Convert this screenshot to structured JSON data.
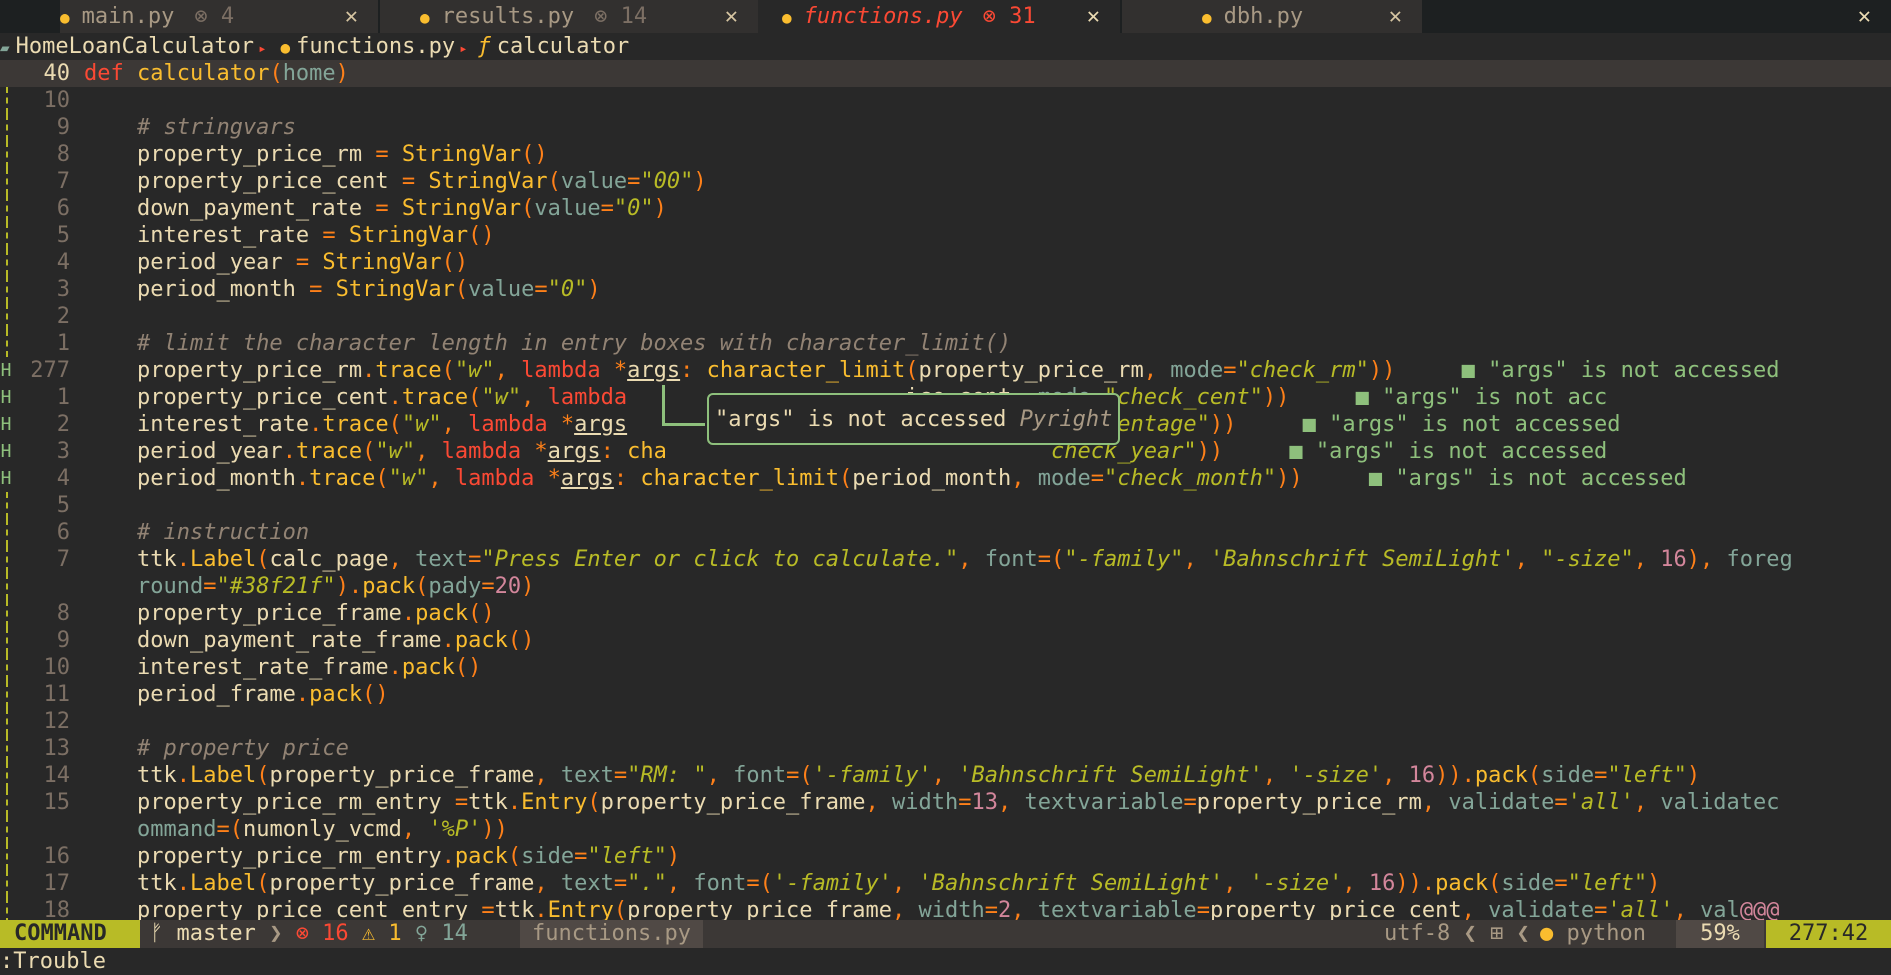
{
  "tabs": [
    {
      "name": "main.py",
      "diag": "⊗ 4",
      "close": "✕"
    },
    {
      "name": "results.py",
      "diag": "⊗ 14",
      "close": "✕"
    },
    {
      "name": "functions.py",
      "diag": "⊗ 31",
      "close": "✕"
    },
    {
      "name": "dbh.py",
      "diag": "",
      "close": "✕"
    }
  ],
  "window_close": "✕",
  "breadcrumb": {
    "project": "HomeLoanCalculator",
    "file": "functions.py",
    "symbol": "calculator"
  },
  "hover": {
    "message": "\"args\" is not accessed",
    "source": "Pyright"
  },
  "diagnostic_hint": "■ \"args\" is not accessed",
  "status": {
    "mode": "COMMAND",
    "branch": "master",
    "errors": "⊗ 16",
    "warnings": "⚠ 1",
    "hints": "♀ 14",
    "file": "functions.py",
    "encoding": "utf-8",
    "filetype": "python",
    "percent": "59%",
    "position": "277:42"
  },
  "cmdline": ":Trouble",
  "lines": [
    {
      "mk": "",
      "n": "40",
      "cur": true
    },
    {
      "mk": "bar",
      "n": "10"
    },
    {
      "mk": "bar",
      "n": "9"
    },
    {
      "mk": "bar",
      "n": "8"
    },
    {
      "mk": "bar",
      "n": "7"
    },
    {
      "mk": "bar",
      "n": "6"
    },
    {
      "mk": "bar",
      "n": "5"
    },
    {
      "mk": "bar",
      "n": "4"
    },
    {
      "mk": "bar",
      "n": "3"
    },
    {
      "mk": "bar",
      "n": "2"
    },
    {
      "mk": "bar",
      "n": "1"
    },
    {
      "mk": "H",
      "n": "277"
    },
    {
      "mk": "H",
      "n": "1"
    },
    {
      "mk": "H",
      "n": "2"
    },
    {
      "mk": "H",
      "n": "3"
    },
    {
      "mk": "H",
      "n": "4"
    },
    {
      "mk": "bar",
      "n": "5"
    },
    {
      "mk": "bar",
      "n": "6"
    },
    {
      "mk": "bar",
      "n": "7"
    },
    {
      "mk": "bar",
      "n": ""
    },
    {
      "mk": "bar",
      "n": "8"
    },
    {
      "mk": "bar",
      "n": "9"
    },
    {
      "mk": "bar",
      "n": "10"
    },
    {
      "mk": "bar",
      "n": "11"
    },
    {
      "mk": "bar",
      "n": "12"
    },
    {
      "mk": "bar",
      "n": "13"
    },
    {
      "mk": "bar",
      "n": "14"
    },
    {
      "mk": "bar",
      "n": "15"
    },
    {
      "mk": "bar",
      "n": ""
    },
    {
      "mk": "bar",
      "n": "16"
    },
    {
      "mk": "bar",
      "n": "17"
    },
    {
      "mk": "bar",
      "n": "18"
    }
  ],
  "code": [
    [
      [
        "kw",
        "def "
      ],
      [
        "fn",
        "calculator"
      ],
      [
        "pu",
        "("
      ],
      [
        "par",
        "home"
      ],
      [
        "pu",
        ")"
      ]
    ],
    [],
    [
      [
        "cm",
        "    # stringvars"
      ]
    ],
    [
      [
        "",
        "    property_price_rm "
      ],
      [
        "op",
        "="
      ],
      [
        "fn",
        " StringVar"
      ],
      [
        "pu",
        "()"
      ]
    ],
    [
      [
        "",
        "    property_price_cent "
      ],
      [
        "op",
        "="
      ],
      [
        "fn",
        " StringVar"
      ],
      [
        "pu",
        "("
      ],
      [
        "par",
        "value"
      ],
      [
        "op",
        "="
      ],
      [
        "st",
        "\"00\""
      ],
      [
        "pu",
        ")"
      ]
    ],
    [
      [
        "",
        "    down_payment_rate "
      ],
      [
        "op",
        "="
      ],
      [
        "fn",
        " StringVar"
      ],
      [
        "pu",
        "("
      ],
      [
        "par",
        "value"
      ],
      [
        "op",
        "="
      ],
      [
        "st",
        "\"0\""
      ],
      [
        "pu",
        ")"
      ]
    ],
    [
      [
        "",
        "    interest_rate "
      ],
      [
        "op",
        "="
      ],
      [
        "fn",
        " StringVar"
      ],
      [
        "pu",
        "()"
      ]
    ],
    [
      [
        "",
        "    period_year "
      ],
      [
        "op",
        "="
      ],
      [
        "fn",
        " StringVar"
      ],
      [
        "pu",
        "()"
      ]
    ],
    [
      [
        "",
        "    period_month "
      ],
      [
        "op",
        "="
      ],
      [
        "fn",
        " StringVar"
      ],
      [
        "pu",
        "("
      ],
      [
        "par",
        "value"
      ],
      [
        "op",
        "="
      ],
      [
        "st",
        "\"0\""
      ],
      [
        "pu",
        ")"
      ]
    ],
    [],
    [
      [
        "cm",
        "    # limit the character length in entry boxes with character_limit()"
      ]
    ],
    [
      [
        "",
        "    property_price_rm"
      ],
      [
        "op",
        "."
      ],
      [
        "fn",
        "trace"
      ],
      [
        "pu",
        "("
      ],
      [
        "st",
        "\"w\""
      ],
      [
        "pu",
        ", "
      ],
      [
        "kw",
        "lambda "
      ],
      [
        "op",
        "*"
      ],
      [
        "ul",
        "args"
      ],
      [
        "pu",
        ": "
      ],
      [
        "fn",
        "character_limit"
      ],
      [
        "pu",
        "("
      ],
      [
        "",
        "property_price_rm"
      ],
      [
        "pu",
        ", "
      ],
      [
        "par",
        "mode"
      ],
      [
        "op",
        "="
      ],
      [
        "st",
        "\"check_rm\""
      ],
      [
        "pu",
        "))"
      ],
      [
        "",
        "     "
      ],
      [
        "hint",
        "■ \"args\" is not accessed"
      ]
    ],
    [
      [
        "",
        "    property_price_cent"
      ],
      [
        "op",
        "."
      ],
      [
        "fn",
        "trace"
      ],
      [
        "pu",
        "("
      ],
      [
        "st",
        "\"w\""
      ],
      [
        "pu",
        ", "
      ],
      [
        "kw",
        "lambda"
      ],
      [
        "",
        "                     ice_cent"
      ],
      [
        "pu",
        ", "
      ],
      [
        "par",
        "mode"
      ],
      [
        "op",
        "="
      ],
      [
        "st",
        "\"check_cent\""
      ],
      [
        "pu",
        "))"
      ],
      [
        "",
        "     "
      ],
      [
        "hint",
        "■ \"args\" is not acc"
      ]
    ],
    [
      [
        "",
        "    interest_rate"
      ],
      [
        "op",
        "."
      ],
      [
        "fn",
        "trace"
      ],
      [
        "pu",
        "("
      ],
      [
        "st",
        "\"w\""
      ],
      [
        "pu",
        ", "
      ],
      [
        "kw",
        "lambda "
      ],
      [
        "op",
        "*"
      ],
      [
        "ul",
        "args"
      ],
      [
        "",
        "                       de"
      ],
      [
        "op",
        "="
      ],
      [
        "st",
        "\"check_percentage\""
      ],
      [
        "pu",
        "))"
      ],
      [
        "",
        "     "
      ],
      [
        "hint",
        "■ \"args\" is not accessed"
      ]
    ],
    [
      [
        "",
        "    period_year"
      ],
      [
        "op",
        "."
      ],
      [
        "fn",
        "trace"
      ],
      [
        "pu",
        "("
      ],
      [
        "st",
        "\"w\""
      ],
      [
        "pu",
        ", "
      ],
      [
        "kw",
        "lambda "
      ],
      [
        "op",
        "*"
      ],
      [
        "ul",
        "args"
      ],
      [
        "pu",
        ": "
      ],
      [
        "fn",
        "cha"
      ],
      [
        "",
        "                             "
      ],
      [
        "st",
        "check_year\""
      ],
      [
        "pu",
        "))"
      ],
      [
        "",
        "     "
      ],
      [
        "hint",
        "■ \"args\" is not accessed"
      ]
    ],
    [
      [
        "",
        "    period_month"
      ],
      [
        "op",
        "."
      ],
      [
        "fn",
        "trace"
      ],
      [
        "pu",
        "("
      ],
      [
        "st",
        "\"w\""
      ],
      [
        "pu",
        ", "
      ],
      [
        "kw",
        "lambda "
      ],
      [
        "op",
        "*"
      ],
      [
        "ul",
        "args"
      ],
      [
        "pu",
        ": "
      ],
      [
        "fn",
        "character_limit"
      ],
      [
        "pu",
        "("
      ],
      [
        "",
        "period_month"
      ],
      [
        "pu",
        ", "
      ],
      [
        "par",
        "mode"
      ],
      [
        "op",
        "="
      ],
      [
        "st",
        "\"check_month\""
      ],
      [
        "pu",
        "))"
      ],
      [
        "",
        "     "
      ],
      [
        "hint",
        "■ \"args\" is not accessed"
      ]
    ],
    [],
    [
      [
        "cm",
        "    # instruction"
      ]
    ],
    [
      [
        "",
        "    ttk"
      ],
      [
        "op",
        "."
      ],
      [
        "fn",
        "Label"
      ],
      [
        "pu",
        "("
      ],
      [
        "",
        "calc_page"
      ],
      [
        "pu",
        ", "
      ],
      [
        "par",
        "text"
      ],
      [
        "op",
        "="
      ],
      [
        "st",
        "\"Press Enter or click to calculate.\""
      ],
      [
        "pu",
        ", "
      ],
      [
        "par",
        "font"
      ],
      [
        "op",
        "="
      ],
      [
        "pu",
        "("
      ],
      [
        "st",
        "\"-family\""
      ],
      [
        "pu",
        ", "
      ],
      [
        "st",
        "'Bahnschrift SemiLight'"
      ],
      [
        "pu",
        ", "
      ],
      [
        "st",
        "\"-size\""
      ],
      [
        "pu",
        ", "
      ],
      [
        "nm",
        "16"
      ],
      [
        "pu",
        "), "
      ],
      [
        "par",
        "foreg"
      ]
    ],
    [
      [
        "par",
        "    round"
      ],
      [
        "op",
        "="
      ],
      [
        "st",
        "\"#38f21f\""
      ],
      [
        "pu",
        ")."
      ],
      [
        "fn",
        "pack"
      ],
      [
        "pu",
        "("
      ],
      [
        "par",
        "pady"
      ],
      [
        "op",
        "="
      ],
      [
        "nm",
        "20"
      ],
      [
        "pu",
        ")"
      ]
    ],
    [
      [
        "",
        "    property_price_frame"
      ],
      [
        "op",
        "."
      ],
      [
        "fn",
        "pack"
      ],
      [
        "pu",
        "()"
      ]
    ],
    [
      [
        "",
        "    down_payment_rate_frame"
      ],
      [
        "op",
        "."
      ],
      [
        "fn",
        "pack"
      ],
      [
        "pu",
        "()"
      ]
    ],
    [
      [
        "",
        "    interest_rate_frame"
      ],
      [
        "op",
        "."
      ],
      [
        "fn",
        "pack"
      ],
      [
        "pu",
        "()"
      ]
    ],
    [
      [
        "",
        "    period_frame"
      ],
      [
        "op",
        "."
      ],
      [
        "fn",
        "pack"
      ],
      [
        "pu",
        "()"
      ]
    ],
    [],
    [
      [
        "cm",
        "    # property price"
      ]
    ],
    [
      [
        "",
        "    ttk"
      ],
      [
        "op",
        "."
      ],
      [
        "fn",
        "Label"
      ],
      [
        "pu",
        "("
      ],
      [
        "",
        "property_price_frame"
      ],
      [
        "pu",
        ", "
      ],
      [
        "par",
        "text"
      ],
      [
        "op",
        "="
      ],
      [
        "st",
        "\"RM: \""
      ],
      [
        "pu",
        ", "
      ],
      [
        "par",
        "font"
      ],
      [
        "op",
        "="
      ],
      [
        "pu",
        "("
      ],
      [
        "st",
        "'-family'"
      ],
      [
        "pu",
        ", "
      ],
      [
        "st",
        "'Bahnschrift SemiLight'"
      ],
      [
        "pu",
        ", "
      ],
      [
        "st",
        "'-size'"
      ],
      [
        "pu",
        ", "
      ],
      [
        "nm",
        "16"
      ],
      [
        "pu",
        "))."
      ],
      [
        "fn",
        "pack"
      ],
      [
        "pu",
        "("
      ],
      [
        "par",
        "side"
      ],
      [
        "op",
        "="
      ],
      [
        "st",
        "\"left\""
      ],
      [
        "pu",
        ")"
      ]
    ],
    [
      [
        "",
        "    property_price_rm_entry "
      ],
      [
        "op",
        "="
      ],
      [
        "",
        "ttk"
      ],
      [
        "op",
        "."
      ],
      [
        "fn",
        "Entry"
      ],
      [
        "pu",
        "("
      ],
      [
        "",
        "property_price_frame"
      ],
      [
        "pu",
        ", "
      ],
      [
        "par",
        "width"
      ],
      [
        "op",
        "="
      ],
      [
        "nm",
        "13"
      ],
      [
        "pu",
        ", "
      ],
      [
        "par",
        "textvariable"
      ],
      [
        "op",
        "="
      ],
      [
        "",
        "property_price_rm"
      ],
      [
        "pu",
        ", "
      ],
      [
        "par",
        "validate"
      ],
      [
        "op",
        "="
      ],
      [
        "st",
        "'all'"
      ],
      [
        "pu",
        ", "
      ],
      [
        "par",
        "validatec"
      ]
    ],
    [
      [
        "par",
        "    ommand"
      ],
      [
        "op",
        "="
      ],
      [
        "pu",
        "("
      ],
      [
        "",
        "numonly_vcmd"
      ],
      [
        "pu",
        ", "
      ],
      [
        "st",
        "'%P'"
      ],
      [
        "pu",
        "))"
      ]
    ],
    [
      [
        "",
        "    property_price_rm_entry"
      ],
      [
        "op",
        "."
      ],
      [
        "fn",
        "pack"
      ],
      [
        "pu",
        "("
      ],
      [
        "par",
        "side"
      ],
      [
        "op",
        "="
      ],
      [
        "st",
        "\"left\""
      ],
      [
        "pu",
        ")"
      ]
    ],
    [
      [
        "",
        "    ttk"
      ],
      [
        "op",
        "."
      ],
      [
        "fn",
        "Label"
      ],
      [
        "pu",
        "("
      ],
      [
        "",
        "property_price_frame"
      ],
      [
        "pu",
        ", "
      ],
      [
        "par",
        "text"
      ],
      [
        "op",
        "="
      ],
      [
        "st",
        "\".\""
      ],
      [
        "pu",
        ", "
      ],
      [
        "par",
        "font"
      ],
      [
        "op",
        "="
      ],
      [
        "pu",
        "("
      ],
      [
        "st",
        "'-family'"
      ],
      [
        "pu",
        ", "
      ],
      [
        "st",
        "'Bahnschrift SemiLight'"
      ],
      [
        "pu",
        ", "
      ],
      [
        "st",
        "'-size'"
      ],
      [
        "pu",
        ", "
      ],
      [
        "nm",
        "16"
      ],
      [
        "pu",
        "))."
      ],
      [
        "fn",
        "pack"
      ],
      [
        "pu",
        "("
      ],
      [
        "par",
        "side"
      ],
      [
        "op",
        "="
      ],
      [
        "st",
        "\"left\""
      ],
      [
        "pu",
        ")"
      ]
    ],
    [
      [
        "",
        "    property_price_cent_entry "
      ],
      [
        "op",
        "="
      ],
      [
        "",
        "ttk"
      ],
      [
        "op",
        "."
      ],
      [
        "fn",
        "Entry"
      ],
      [
        "pu",
        "("
      ],
      [
        "",
        "property_price_frame"
      ],
      [
        "pu",
        ", "
      ],
      [
        "par",
        "width"
      ],
      [
        "op",
        "="
      ],
      [
        "nm",
        "2"
      ],
      [
        "pu",
        ", "
      ],
      [
        "par",
        "textvariable"
      ],
      [
        "op",
        "="
      ],
      [
        "",
        "property_price_cent"
      ],
      [
        "pu",
        ", "
      ],
      [
        "par",
        "validate"
      ],
      [
        "op",
        "="
      ],
      [
        "st",
        "'all'"
      ],
      [
        "pu",
        ", "
      ],
      [
        "par",
        "val"
      ],
      [
        "nm",
        "@@@"
      ]
    ]
  ]
}
